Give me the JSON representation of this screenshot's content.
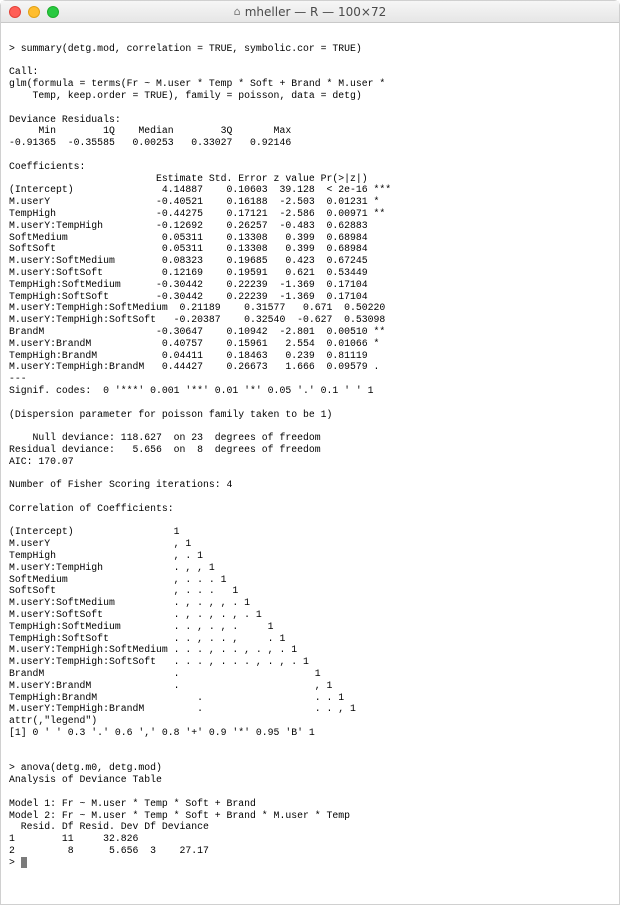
{
  "window": {
    "title": "mheller — R — 100×72"
  },
  "terminal": {
    "prompt1": "> summary(detg.mod, correlation = TRUE, symbolic.cor = TRUE)",
    "blank": "",
    "call_hdr": "Call:",
    "call_l1": "glm(formula = terms(Fr ~ M.user * Temp * Soft + Brand * M.user * ",
    "call_l2": "    Temp, keep.order = TRUE), family = poisson, data = detg)",
    "dev_hdr": "Deviance Residuals: ",
    "dev_cols": "     Min        1Q    Median        3Q       Max  ",
    "dev_vals": "-0.91365  -0.35585   0.00253   0.33027   0.92146  ",
    "coef_hdr": "Coefficients:",
    "coef_cols": "                         Estimate Std. Error z value Pr(>|z|)    ",
    "c01": "(Intercept)               4.14887    0.10603  39.128  < 2e-16 ***",
    "c02": "M.userY                  -0.40521    0.16188  -2.503  0.01231 *  ",
    "c03": "TempHigh                 -0.44275    0.17121  -2.586  0.00971 ** ",
    "c04": "M.userY:TempHigh         -0.12692    0.26257  -0.483  0.62883    ",
    "c05": "SoftMedium                0.05311    0.13308   0.399  0.68984    ",
    "c06": "SoftSoft                  0.05311    0.13308   0.399  0.68984    ",
    "c07": "M.userY:SoftMedium        0.08323    0.19685   0.423  0.67245    ",
    "c08": "M.userY:SoftSoft          0.12169    0.19591   0.621  0.53449    ",
    "c09": "TempHigh:SoftMedium      -0.30442    0.22239  -1.369  0.17104    ",
    "c10": "TempHigh:SoftSoft        -0.30442    0.22239  -1.369  0.17104    ",
    "c11": "M.userY:TempHigh:SoftMedium  0.21189    0.31577   0.671  0.50220    ",
    "c12": "M.userY:TempHigh:SoftSoft   -0.20387    0.32540  -0.627  0.53098    ",
    "c13": "BrandM                   -0.30647    0.10942  -2.801  0.00510 ** ",
    "c14": "M.userY:BrandM            0.40757    0.15961   2.554  0.01066 *  ",
    "c15": "TempHigh:BrandM           0.04411    0.18463   0.239  0.81119    ",
    "c16": "M.userY:TempHigh:BrandM   0.44427    0.26673   1.666  0.09579 .  ",
    "sigdash": "---",
    "sigcodes": "Signif. codes:  0 '***' 0.001 '**' 0.01 '*' 0.05 '.' 0.1 ' ' 1",
    "disp": "(Dispersion parameter for poisson family taken to be 1)",
    "nulldev": "    Null deviance: 118.627  on 23  degrees of freedom",
    "resdev": "Residual deviance:   5.656  on  8  degrees of freedom",
    "aic": "AIC: 170.07",
    "fisher": "Number of Fisher Scoring iterations: 4",
    "corr_hdr": "Correlation of Coefficients:",
    "r01": "(Intercept)                 1                            ",
    "r02": "M.userY                     , 1                          ",
    "r03": "TempHigh                    , . 1                        ",
    "r04": "M.userY:TempHigh            . , , 1                      ",
    "r05": "SoftMedium                  , . . . 1                    ",
    "r06": "SoftSoft                    , . . .   1                  ",
    "r07": "M.userY:SoftMedium          . , . , , . 1                ",
    "r08": "M.userY:SoftSoft            . , . , . , . 1              ",
    "r09": "TempHigh:SoftMedium         . . , . , .     1            ",
    "r10": "TempHigh:SoftSoft           . . , . . ,     . 1          ",
    "r11": "M.userY:TempHigh:SoftMedium . . . , . . , . , . 1        ",
    "r12": "M.userY:TempHigh:SoftSoft   . . . , . . . , . , . 1      ",
    "r13": "BrandM                      .                       1    ",
    "r14": "M.userY:BrandM              .                       , 1  ",
    "r15": "TempHigh:BrandM                 .                   . . 1",
    "r16": "M.userY:TempHigh:BrandM         .                   . . , 1",
    "attr": "attr(,\"legend\")",
    "legend": "[1] 0 ' ' 0.3 '.' 0.6 ',' 0.8 '+' 0.9 '*' 0.95 'B' 1",
    "prompt2": "> anova(detg.m0, detg.mod)",
    "anova_hdr": "Analysis of Deviance Table",
    "m1": "Model 1: Fr ~ M.user * Temp * Soft + Brand",
    "m2": "Model 2: Fr ~ M.user * Temp * Soft + Brand * M.user * Temp",
    "anv_cols": "  Resid. Df Resid. Dev Df Deviance",
    "anv_r1": "1        11     32.826            ",
    "anv_r2": "2         8      5.656  3    27.17",
    "prompt3": "> "
  }
}
